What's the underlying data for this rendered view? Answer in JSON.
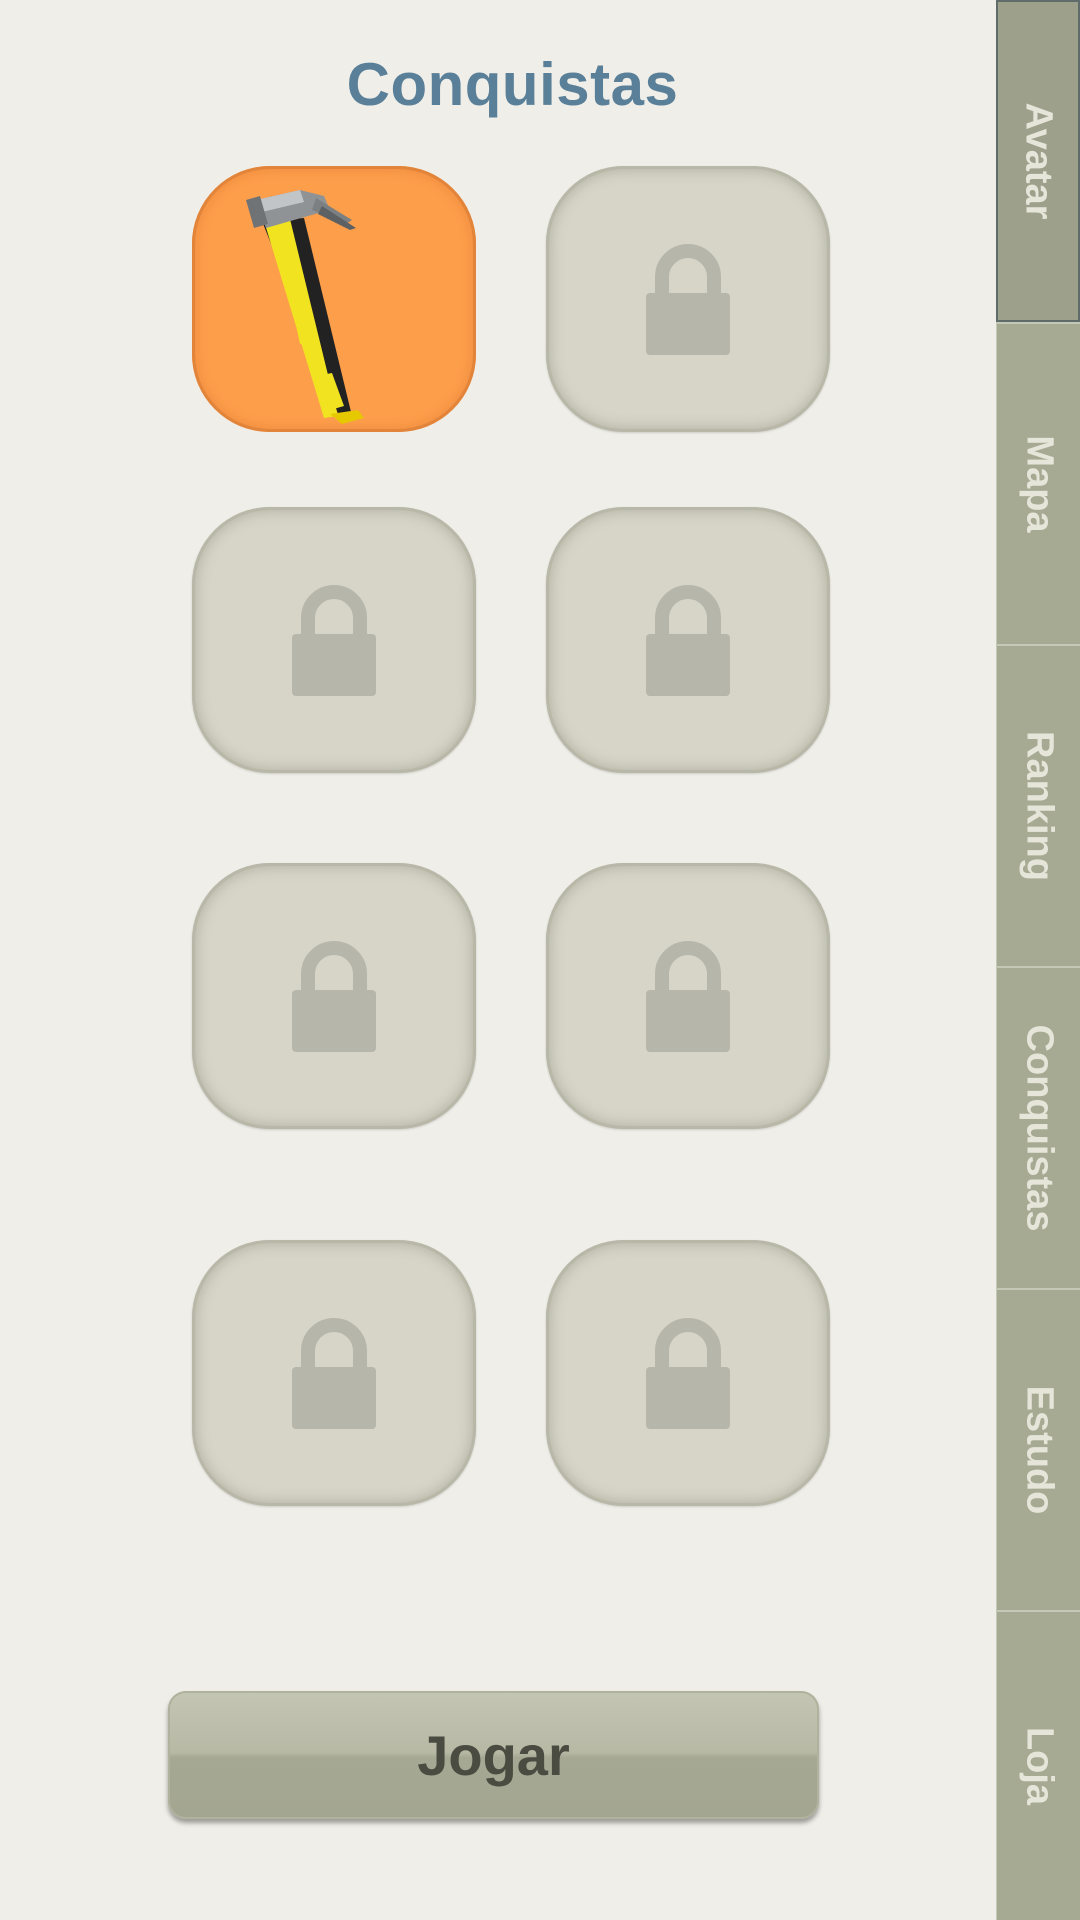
{
  "page": {
    "title": "Conquistas"
  },
  "achievements": [
    {
      "state": "unlocked",
      "icon": "hammer-icon"
    },
    {
      "state": "locked",
      "icon": "lock-icon"
    },
    {
      "state": "locked",
      "icon": "lock-icon"
    },
    {
      "state": "locked",
      "icon": "lock-icon"
    },
    {
      "state": "locked",
      "icon": "lock-icon"
    },
    {
      "state": "locked",
      "icon": "lock-icon"
    },
    {
      "state": "locked",
      "icon": "lock-icon"
    },
    {
      "state": "locked",
      "icon": "lock-icon"
    }
  ],
  "sidebar": {
    "tabs": [
      {
        "label": "Avatar",
        "active": true
      },
      {
        "label": "Mapa",
        "active": false
      },
      {
        "label": "Ranking",
        "active": false
      },
      {
        "label": "Conquistas",
        "active": false
      },
      {
        "label": "Estudo",
        "active": false
      },
      {
        "label": "Loja",
        "active": false
      }
    ]
  },
  "actions": {
    "play_label": "Jogar"
  },
  "colors": {
    "title": "#5a7f98",
    "unlocked_tile": "#fd9e4b",
    "locked_tile": "#d6d5c8",
    "tab_background": "#a7aa92"
  }
}
